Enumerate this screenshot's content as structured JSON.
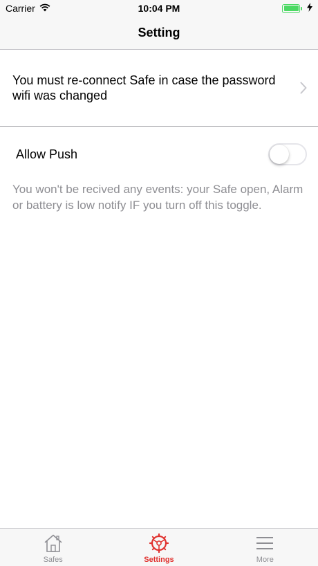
{
  "status_bar": {
    "carrier": "Carrier",
    "time": "10:04 PM",
    "battery_color": "#4cd964"
  },
  "nav": {
    "title": "Setting"
  },
  "reconnect": {
    "text": "You must re-connect Safe in case the password wifi was changed",
    "chevron_icon": "chevron-right-icon"
  },
  "push": {
    "label": "Allow Push",
    "enabled": false,
    "description": "You won't be recived any events: your Safe open, Alarm or battery is low notify IF you turn off this toggle."
  },
  "tabs": [
    {
      "label": "Safes",
      "icon": "house-icon",
      "active": false
    },
    {
      "label": "Settings",
      "icon": "settings-wheel-icon",
      "active": true
    },
    {
      "label": "More",
      "icon": "menu-lines-icon",
      "active": false
    }
  ],
  "colors": {
    "accent": "#e0322f",
    "inactive": "#8e8e93"
  }
}
